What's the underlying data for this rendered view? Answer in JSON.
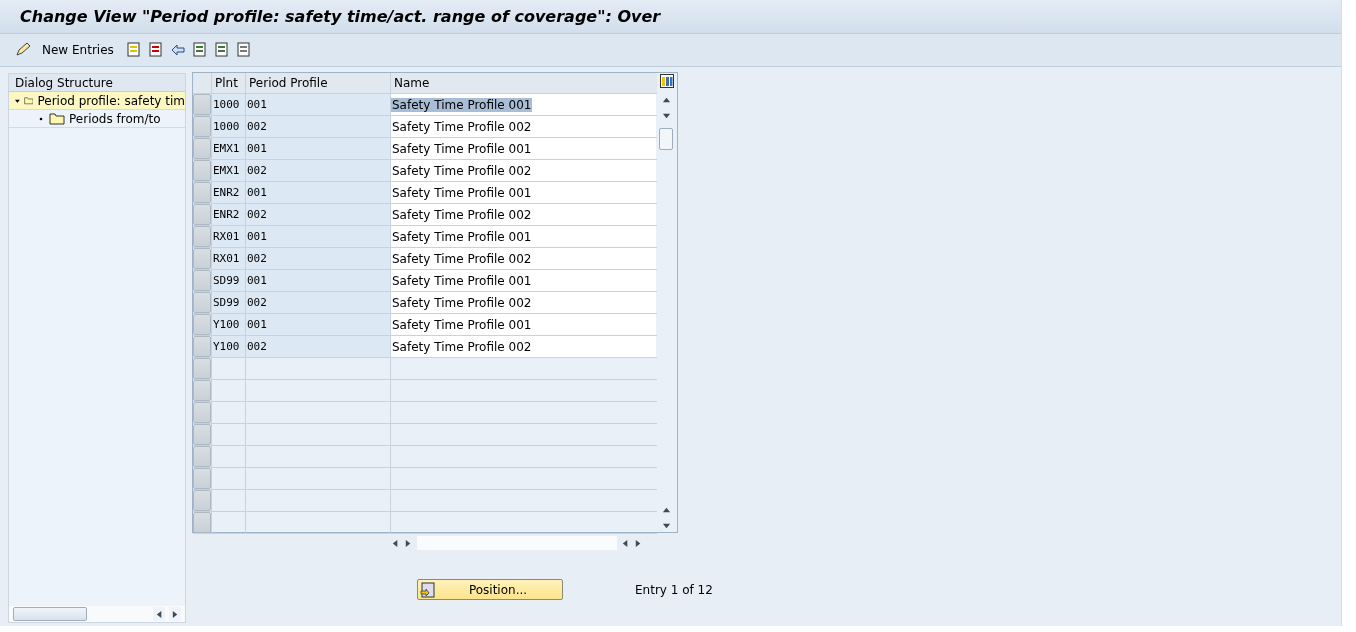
{
  "window": {
    "title": "Change View \"Period profile: safety time/act. range of coverage\": Over"
  },
  "toolbar": {
    "new_entries": "New Entries"
  },
  "dialog_structure": {
    "title": "Dialog Structure",
    "items": [
      {
        "label": "Period profile: safety tim",
        "selected": true,
        "expanded": true,
        "children": [
          {
            "label": "Periods from/to",
            "selected": false
          }
        ]
      }
    ]
  },
  "table": {
    "columns": [
      "Plnt",
      "Period Profile",
      "Name"
    ],
    "rows": [
      {
        "plant": "1000",
        "profile": "001",
        "name": "Safety Time Profile 001",
        "selected": true
      },
      {
        "plant": "1000",
        "profile": "002",
        "name": "Safety Time Profile 002",
        "selected": false
      },
      {
        "plant": "EMX1",
        "profile": "001",
        "name": "Safety Time Profile 001",
        "selected": false
      },
      {
        "plant": "EMX1",
        "profile": "002",
        "name": "Safety Time Profile 002",
        "selected": false
      },
      {
        "plant": "ENR2",
        "profile": "001",
        "name": "Safety Time Profile 001",
        "selected": false
      },
      {
        "plant": "ENR2",
        "profile": "002",
        "name": "Safety Time Profile 002",
        "selected": false
      },
      {
        "plant": "RX01",
        "profile": "001",
        "name": "Safety Time Profile 001",
        "selected": false
      },
      {
        "plant": "RX01",
        "profile": "002",
        "name": "Safety Time Profile 002",
        "selected": false
      },
      {
        "plant": "SD99",
        "profile": "001",
        "name": "Safety Time Profile 001",
        "selected": false
      },
      {
        "plant": "SD99",
        "profile": "002",
        "name": "Safety Time Profile 002",
        "selected": false
      },
      {
        "plant": "Y100",
        "profile": "001",
        "name": "Safety Time Profile 001",
        "selected": false
      },
      {
        "plant": "Y100",
        "profile": "002",
        "name": "Safety Time Profile 002",
        "selected": false
      }
    ]
  },
  "position_button": "Position...",
  "entry_info": "Entry 1 of 12"
}
